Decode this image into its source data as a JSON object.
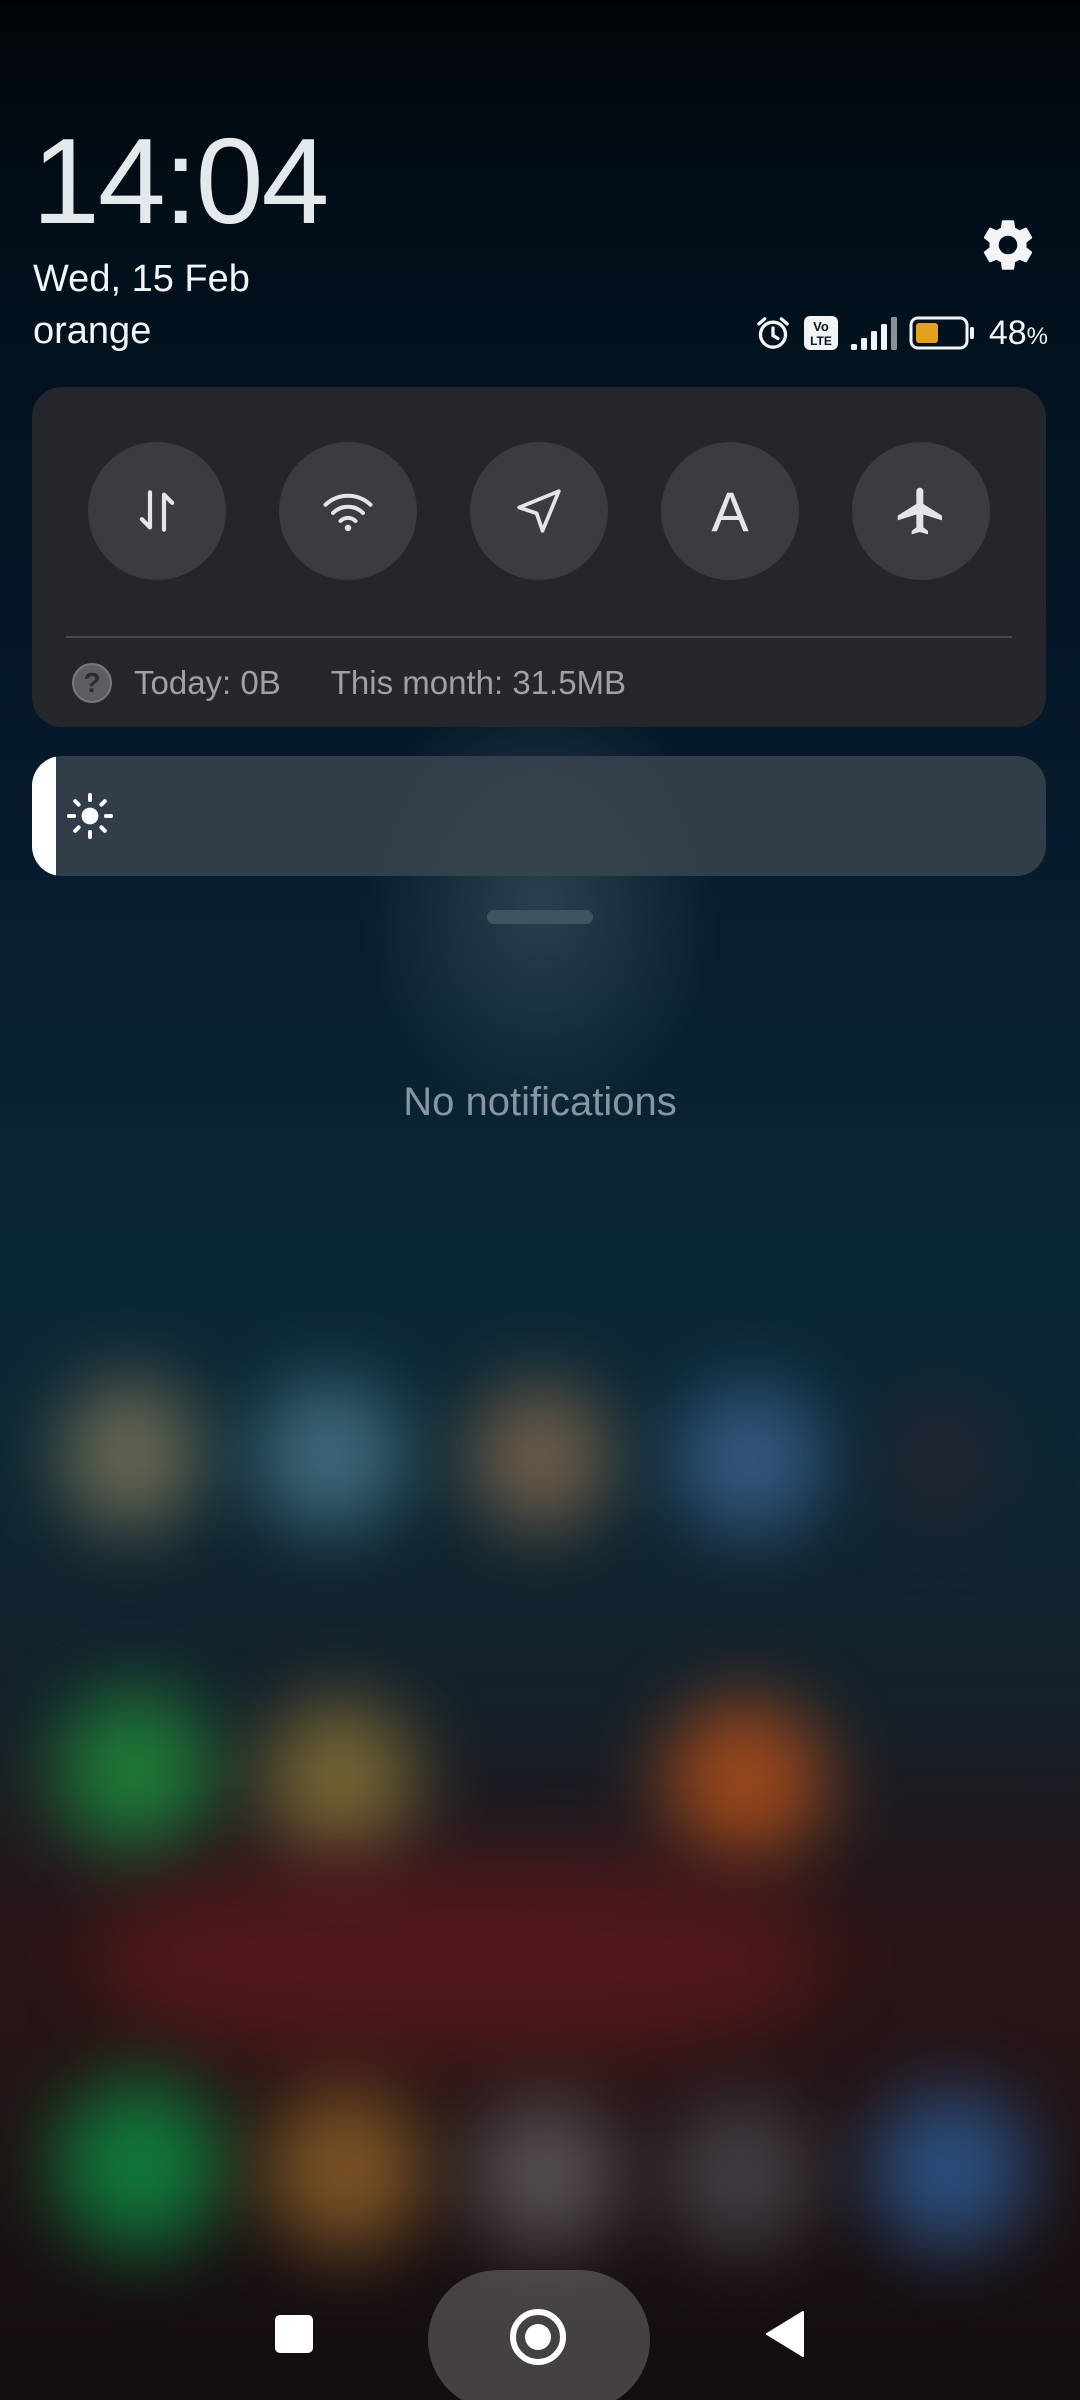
{
  "header": {
    "time": "14:04",
    "date": "Wed, 15 Feb",
    "carrier": "orange"
  },
  "status_bar": {
    "icons": [
      "alarm-icon",
      "volte-icon",
      "signal-icon",
      "battery-icon"
    ],
    "volte_label_top": "Vo",
    "volte_label_bottom": "LTE",
    "battery_percent": "48",
    "battery_percent_sign": "%",
    "battery_level": 0.48,
    "battery_color": "#e6a11c"
  },
  "quick_toggles": [
    {
      "id": "mobile-data",
      "icon": "data-arrows-icon"
    },
    {
      "id": "wifi",
      "icon": "wifi-icon"
    },
    {
      "id": "location",
      "icon": "location-arrow-icon"
    },
    {
      "id": "auto-brightness",
      "icon": "letter-a-icon",
      "label": "A"
    },
    {
      "id": "airplane",
      "icon": "airplane-icon"
    }
  ],
  "data_usage": {
    "help_symbol": "?",
    "today": "Today: 0B",
    "month": "This month: 31.5MB"
  },
  "brightness": {
    "level": 0.024
  },
  "notifications": {
    "empty_text": "No notifications"
  },
  "nav": {
    "icons": [
      "recent-apps-icon",
      "home-icon",
      "back-icon"
    ]
  }
}
